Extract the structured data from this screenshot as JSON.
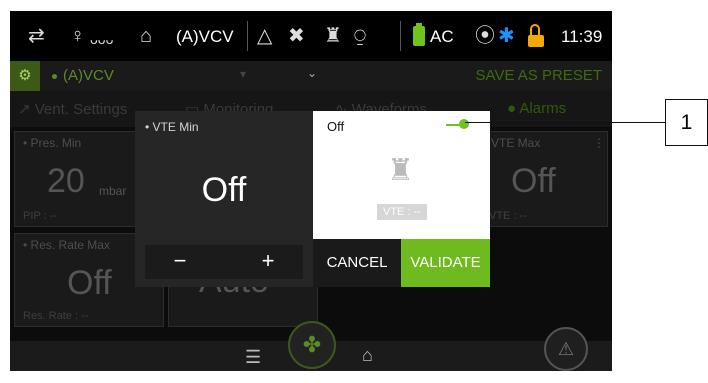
{
  "statusbar": {
    "icons": [
      "network-icon",
      "person-icon",
      "breathing-device-icon",
      "humidifier-icon",
      "alarm-triangle-icon",
      "tools-icon",
      "person-icon",
      "mask-icon",
      "battery-icon",
      "wifi-icon",
      "bluetooth-icon",
      "lock-icon"
    ],
    "mode": "(A)VCV",
    "power": "AC",
    "time": "11:39",
    "colors": {
      "battery": "#6fc41b",
      "bluetooth": "#1e90ff",
      "lock": "#f5a800"
    }
  },
  "modebar": {
    "mode": "(A)VCV",
    "save_preset": "SAVE AS PRESET"
  },
  "tabs": {
    "vent_settings": "Vent. Settings",
    "monitoring": "Monitoring",
    "waveforms": "Waveforms",
    "alarms": "Alarms"
  },
  "tiles": {
    "pres_min": {
      "label": "Pres. Min",
      "value": "20",
      "unit": "mbar",
      "sub": "PIP : --"
    },
    "res_rate_max": {
      "label": "Res. Rate Max",
      "value": "Off",
      "sub": "Res. Rate : --"
    },
    "auto": {
      "value": "Auto"
    },
    "vte_max": {
      "label": "VTE Max",
      "value": "Off",
      "sub": "VTE : --"
    }
  },
  "popup": {
    "title": "VTE Min",
    "value": "Off",
    "minus": "−",
    "plus": "+"
  },
  "panel": {
    "status": "Off",
    "vte_label": "VTE : --"
  },
  "actions": {
    "cancel": "CANCEL",
    "validate": "VALIDATE"
  },
  "callout": {
    "number": "1"
  },
  "colors": {
    "accent_green": "#6fbb1f",
    "dark_bg": "#0c0c0c"
  }
}
